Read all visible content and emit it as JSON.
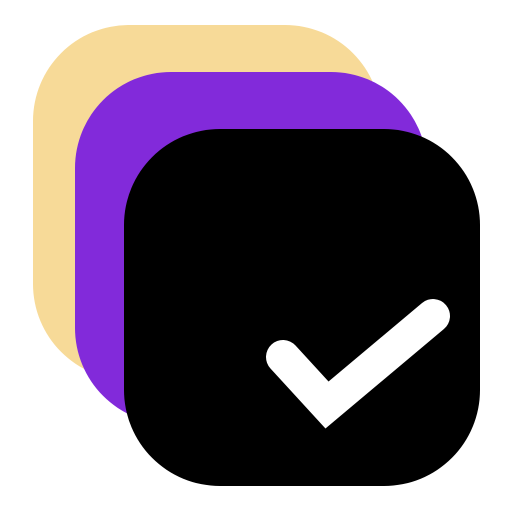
{
  "icon": {
    "name": "stacked-checkbox-icon",
    "layers": [
      {
        "name": "back-square",
        "color": "#F7DA98"
      },
      {
        "name": "middle-square",
        "color": "#822ADA"
      },
      {
        "name": "front-square",
        "color": "#000000"
      }
    ],
    "checkmark": {
      "name": "checkmark-icon",
      "color": "#FFFFFF"
    }
  }
}
